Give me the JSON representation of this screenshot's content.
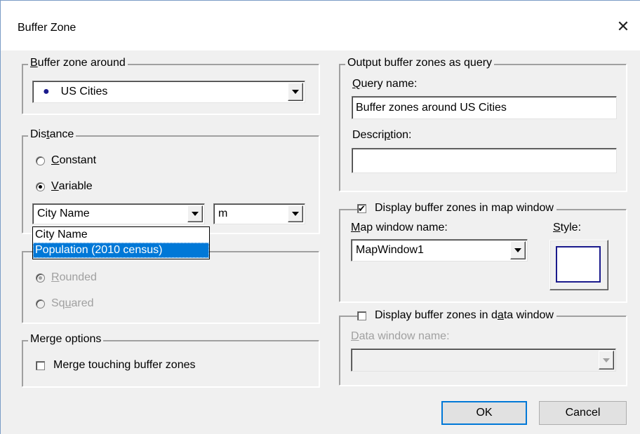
{
  "window": {
    "title": "Buffer Zone",
    "close_glyph": "✕"
  },
  "buffer_around": {
    "label_pre": "",
    "label_accel": "B",
    "label_post": "uffer zone around",
    "selected": "US Cities"
  },
  "distance": {
    "label_pre": "Dis",
    "label_accel": "t",
    "label_post": "ance",
    "constant": {
      "accel": "C",
      "rest": "onstant"
    },
    "variable": {
      "accel": "V",
      "rest": "ariable"
    },
    "field_select": "City Name",
    "unit_select": "m",
    "dropdown_options": [
      "City Name",
      "Population (2010 census)"
    ]
  },
  "shape": {
    "rounded": {
      "accel": "R",
      "rest": "ounded"
    },
    "squared": {
      "pre": "Sq",
      "accel": "u",
      "rest": "ared"
    }
  },
  "merge": {
    "label": "Merge options",
    "checkbox_label": "Merge touching buffer zones"
  },
  "query": {
    "label": "Output buffer zones as query",
    "name_label_accel": "Q",
    "name_label_rest": "uery name:",
    "name_value": "Buffer zones around US Cities",
    "desc_label_pre": "Descri",
    "desc_label_accel": "p",
    "desc_label_rest": "tion:",
    "desc_value": ""
  },
  "map_window": {
    "checkbox_label": "Display buffer zones in map window",
    "checkmark": "✔",
    "name_label_accel": "M",
    "name_label_rest": "ap window name:",
    "name_value": "MapWindow1",
    "style_label_accel": "S",
    "style_label_rest": "tyle:",
    "style_color": "#1a1a8c"
  },
  "data_window": {
    "checkbox_label_pre": "Display buffer zones in d",
    "checkbox_label_accel": "a",
    "checkbox_label_post": "ta window",
    "name_label_accel": "D",
    "name_label_rest": "ata window name:",
    "name_value": ""
  },
  "buttons": {
    "ok": "OK",
    "cancel": "Cancel"
  },
  "colors": {
    "accent": "#0078d7",
    "disabled_text": "#a0a0a0"
  }
}
